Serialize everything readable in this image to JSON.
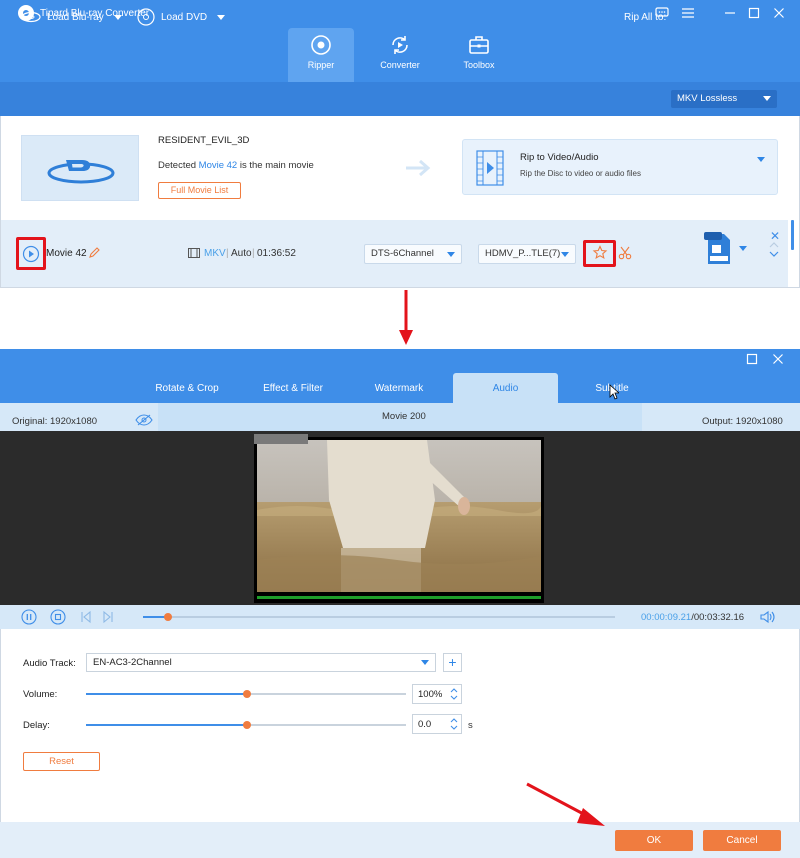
{
  "app": {
    "title": "Tipard Blu-ray Converter",
    "tabs": [
      {
        "label": "Ripper",
        "icon": "ripper-icon",
        "active": true
      },
      {
        "label": "Converter",
        "icon": "converter-icon",
        "active": false
      },
      {
        "label": "Toolbox",
        "icon": "toolbox-icon",
        "active": false
      }
    ],
    "accent_color": "#3f8ee8",
    "action_color": "#f07c3f"
  },
  "toolbar": {
    "load_bluray": "Load Blu-ray",
    "load_dvd": "Load DVD",
    "rip_all_label": "Rip All to:",
    "rip_all_value": "MKV Lossless"
  },
  "disc": {
    "title": "RESIDENT_EVIL_3D",
    "detected_prefix": "Detected",
    "detected_movie": "Movie 42",
    "detected_suffix": "is the main movie",
    "full_list_button": "Full Movie List",
    "rip_title": "Rip to Video/Audio",
    "rip_subtitle": "Rip the Disc to video or audio files"
  },
  "movie_row": {
    "name": "Movie 42",
    "format": "MKV",
    "mode": "Auto",
    "duration": "01:36:52",
    "audio": "DTS-6Channel",
    "subtitle": "HDMV_P...TLE(7)",
    "output_badge": "MKV"
  },
  "editor": {
    "tabs": [
      {
        "label": "Rotate & Crop",
        "active": false
      },
      {
        "label": "Effect & Filter",
        "active": false
      },
      {
        "label": "Watermark",
        "active": false
      },
      {
        "label": "Audio",
        "active": true
      },
      {
        "label": "Subtitle",
        "active": false
      }
    ],
    "original": "Original: 1920x1080",
    "movie_title": "Movie 200",
    "output": "Output: 1920x1080",
    "time_current": "00:00:09.21",
    "time_total": "/00:03:32.16",
    "playback_progress": 0.044,
    "audio_track_label": "Audio Track:",
    "audio_track_value": "EN-AC3-2Channel",
    "volume_label": "Volume:",
    "volume_value": "100%",
    "volume_level": 0.5,
    "delay_label": "Delay:",
    "delay_value": "0.0",
    "delay_unit": "s",
    "delay_level": 0.5,
    "reset_button": "Reset",
    "ok_button": "OK",
    "cancel_button": "Cancel"
  }
}
